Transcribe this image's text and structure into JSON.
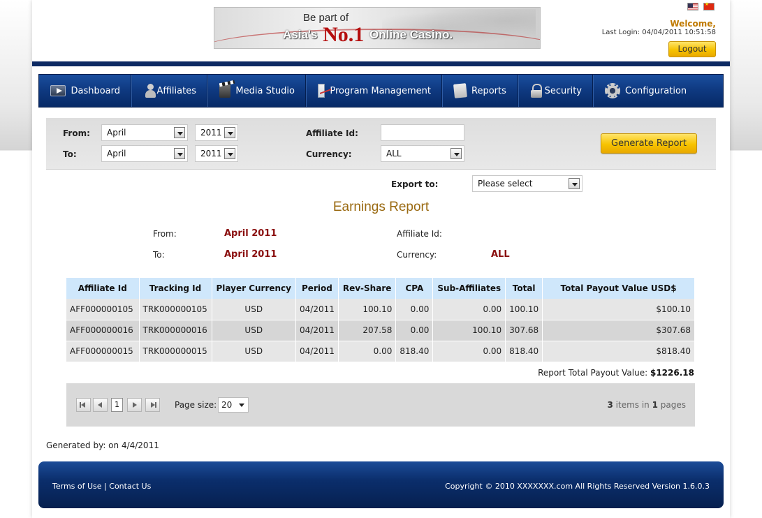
{
  "header": {
    "banner": {
      "line1": "Be part of",
      "line2_pre": "Asia's",
      "line2_big": "No.1",
      "line2_post": "Online Casino."
    },
    "welcome": "Welcome,",
    "last_login": "Last Login: 04/04/2011 10:51:58",
    "logout_label": "Logout"
  },
  "nav": {
    "items": [
      {
        "label": "Dashboard",
        "icon": "dashboard-icon"
      },
      {
        "label": "Affiliates",
        "icon": "user-icon"
      },
      {
        "label": "Media Studio",
        "icon": "clapperboard-icon"
      },
      {
        "label": "Program Management",
        "icon": "chart-icon"
      },
      {
        "label": "Reports",
        "icon": "document-icon"
      },
      {
        "label": "Security",
        "icon": "lock-icon"
      },
      {
        "label": "Configuration",
        "icon": "gear-icon"
      }
    ]
  },
  "filters": {
    "from_label": "From:",
    "to_label": "To:",
    "from_month": "April",
    "from_year": "2011",
    "to_month": "April",
    "to_year": "2011",
    "affiliate_label": "Affiliate Id:",
    "affiliate_value": "",
    "currency_label": "Currency:",
    "currency_value": "ALL",
    "generate_label": "Generate Report",
    "export_label": "Export to:",
    "export_value": "Please select"
  },
  "report": {
    "title": "Earnings Report",
    "from_label": "From:",
    "from_value": "April 2011",
    "to_label": "To:",
    "to_value": "April 2011",
    "affiliate_label": "Affiliate Id:",
    "affiliate_value": "",
    "currency_label": "Currency:",
    "currency_value": "ALL",
    "columns": [
      "Affiliate Id",
      "Tracking Id",
      "Player Currency",
      "Period",
      "Rev-Share",
      "CPA",
      "Sub-Affiliates",
      "Total",
      "Total Payout Value USD$"
    ],
    "rows": [
      [
        "AFF000000105",
        "TRK000000105",
        "USD",
        "04/2011",
        "100.10",
        "0.00",
        "0.00",
        "100.10",
        "$100.10"
      ],
      [
        "AFF000000016",
        "TRK000000016",
        "USD",
        "04/2011",
        "207.58",
        "0.00",
        "100.10",
        "307.68",
        "$307.68"
      ],
      [
        "AFF000000015",
        "TRK000000015",
        "USD",
        "04/2011",
        "0.00",
        "818.40",
        "0.00",
        "818.40",
        "$818.40"
      ]
    ],
    "total_label": "Report Total Payout Value:",
    "total_value": "$1226.18"
  },
  "pager": {
    "current_page": "1",
    "page_size_label": "Page size:",
    "page_size": "20",
    "items": "3",
    "items_text": " items in ",
    "pages": "1",
    "pages_text": " pages"
  },
  "generated_by": "Generated by:  on 4/4/2011",
  "footer": {
    "terms": "Terms of Use",
    "separator": "|",
    "contact": "Contact Us",
    "copyright": "Copyright © 2010 XXXXXXX.com All Rights Reserved  Version 1.6.0.3"
  },
  "colors": {
    "nav": "#0f3a82",
    "button_gold": "#f7c300",
    "report_title": "#9a6a12",
    "value_red": "#8a0f0f",
    "table_header": "#cfe7fb"
  }
}
